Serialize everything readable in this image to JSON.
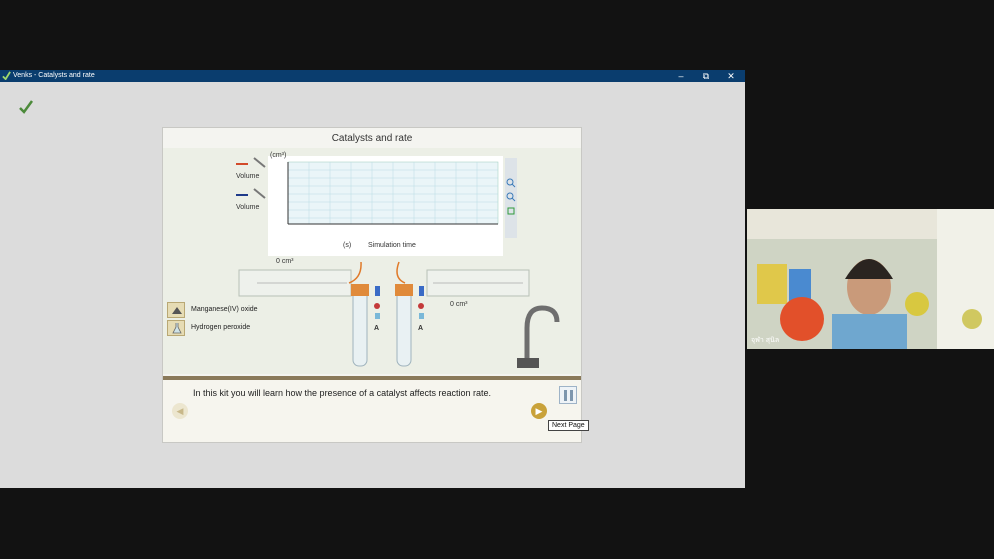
{
  "window": {
    "title": "Venks - Catalysts and rate",
    "minimize": "–",
    "restore": "⧉",
    "close": "✕"
  },
  "sim": {
    "title": "Catalysts and rate",
    "graph": {
      "y_unit": "(cm³)",
      "x_unit": "(s)",
      "x_label": "Simulation time",
      "legend": [
        {
          "label": "Volume",
          "color": "#d24a2a"
        },
        {
          "label": "Volume",
          "color": "#1e3a8a"
        }
      ]
    },
    "left_volume": "0 cm³",
    "right_volume": "0 cm³",
    "reagents": [
      {
        "label": "Manganese(IV) oxide",
        "icon": "triangle-icon"
      },
      {
        "label": "Hydrogen peroxide",
        "icon": "flask-icon"
      }
    ],
    "tube_labels": [
      "A",
      "A"
    ],
    "caption": "In this kit you will learn how the presence of a catalyst affects reaction rate.",
    "tooltip": "Next Page",
    "prev_glyph": "◀",
    "next_glyph": "▶"
  },
  "webcam": {
    "name": "จุฬา สุนิล"
  }
}
